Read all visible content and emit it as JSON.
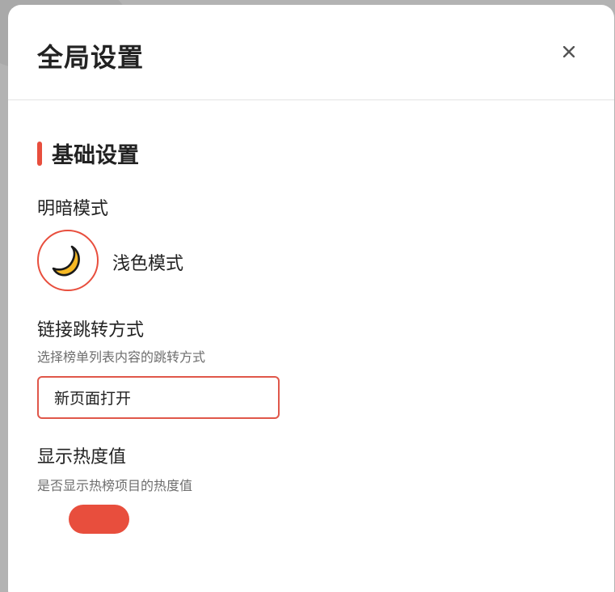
{
  "dialog": {
    "title": "全局设置",
    "close_icon": "close-icon"
  },
  "basic_section": {
    "title": "基础设置"
  },
  "theme_mode": {
    "label": "明暗模式",
    "icon": "moon-icon",
    "value": "浅色模式"
  },
  "link_mode": {
    "label": "链接跳转方式",
    "description": "选择榜单列表内容的跳转方式",
    "selected": "新页面打开"
  },
  "hot_value": {
    "label": "显示热度值",
    "description": "是否显示热榜项目的热度值",
    "enabled": true
  },
  "colors": {
    "accent": "#e84e3d",
    "moon": "#f7b924"
  }
}
